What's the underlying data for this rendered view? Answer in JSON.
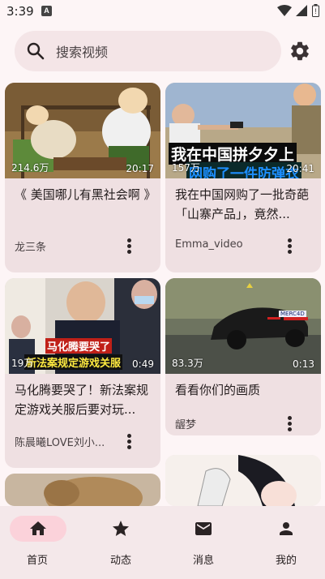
{
  "status_bar": {
    "time": "3:39",
    "notif_icon": "A"
  },
  "search": {
    "placeholder": "搜索视频"
  },
  "videos": [
    {
      "views": "214.6万",
      "duration": "20:17",
      "title": "《 美国哪儿有黑社会啊 》",
      "author": "龙三条",
      "thumb_caption": ""
    },
    {
      "views": "157万",
      "duration": "20:41",
      "title": "我在中国网购了一批奇葩「山寨产品」，竟然...",
      "author": "Emma_video",
      "thumb_caption": "我在中国拼夕夕上",
      "thumb_caption2": "网购了一件防弹衣"
    },
    {
      "views": "19万",
      "duration": "0:49",
      "title": "马化腾要哭了！新法案规定游戏关服后要对玩...",
      "author": "陈晨曦LOVE刘小...",
      "thumb_caption": "马化腾要哭了",
      "thumb_caption2": "新法案规定游戏关服"
    },
    {
      "views": "83.3万",
      "duration": "0:13",
      "title": "看看你们的画质",
      "author": "龌梦",
      "plate": "MERC4D"
    }
  ],
  "nav": [
    {
      "label": "首页",
      "icon": "home-icon",
      "active": true
    },
    {
      "label": "动态",
      "icon": "star-icon",
      "active": false
    },
    {
      "label": "消息",
      "icon": "mail-icon",
      "active": false
    },
    {
      "label": "我的",
      "icon": "person-icon",
      "active": false
    }
  ],
  "colors": {
    "nav_active": "#fbd2da",
    "card_bg": "#efe0e2",
    "page_bg": "#fdf5f6"
  }
}
